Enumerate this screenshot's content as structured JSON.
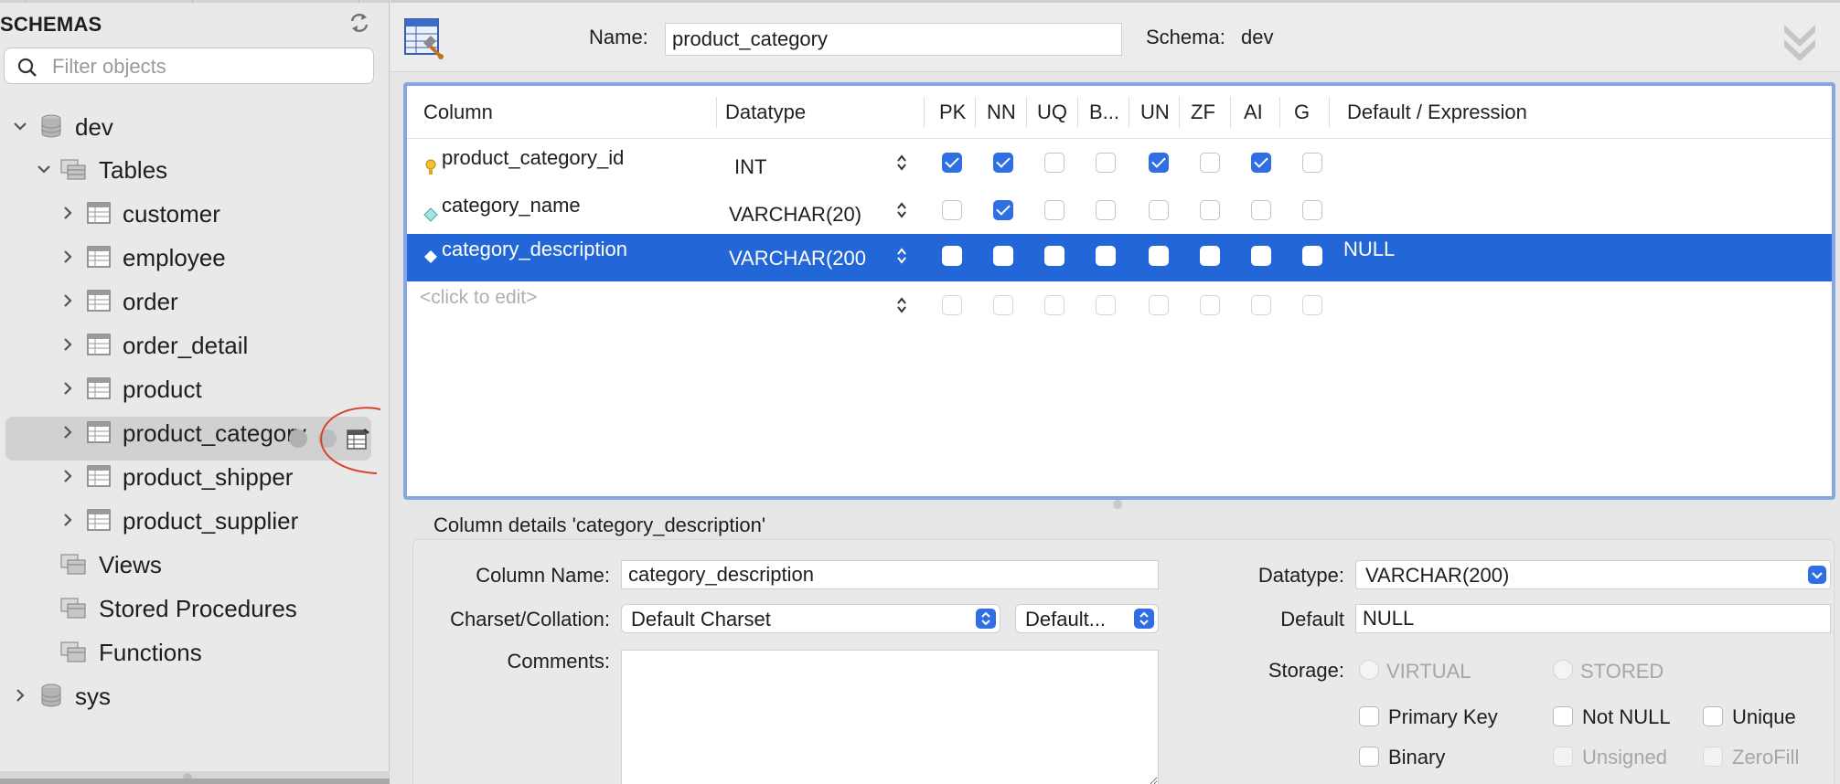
{
  "sidebar": {
    "title": "SCHEMAS",
    "filter_placeholder": "Filter objects",
    "tree": {
      "schema_dev": "dev",
      "tables_folder": "Tables",
      "tables": [
        "customer",
        "employee",
        "order",
        "order_detail",
        "product",
        "product_category",
        "product_shipper",
        "product_supplier"
      ],
      "views_folder": "Views",
      "procedures_folder": "Stored Procedures",
      "functions_folder": "Functions",
      "schema_sys": "sys"
    },
    "selected_table": "product_category"
  },
  "header": {
    "name_label": "Name:",
    "name_value": "product_category",
    "schema_label": "Schema:",
    "schema_value": "dev"
  },
  "grid": {
    "columns": [
      "Column",
      "Datatype",
      "PK",
      "NN",
      "UQ",
      "B...",
      "UN",
      "ZF",
      "AI",
      "G",
      "Default / Expression"
    ],
    "rows": [
      {
        "name": "product_category_id",
        "type": "INT",
        "flags": [
          true,
          true,
          false,
          false,
          true,
          false,
          true,
          false
        ],
        "default": "",
        "icon": "primary-key-icon"
      },
      {
        "name": "category_name",
        "type": "VARCHAR(20)",
        "flags": [
          false,
          true,
          false,
          false,
          false,
          false,
          false,
          false
        ],
        "default": "",
        "icon": "column-diamond-icon"
      },
      {
        "name": "category_description",
        "type": "VARCHAR(200",
        "flags": [
          false,
          false,
          false,
          false,
          false,
          false,
          false,
          false
        ],
        "default": "NULL",
        "icon": "column-diamond-icon",
        "selected": true
      }
    ],
    "placeholder_row": "<click to edit>"
  },
  "details": {
    "title": "Column details 'category_description'",
    "column_name_label": "Column Name:",
    "column_name_value": "category_description",
    "charset_label": "Charset/Collation:",
    "charset_value": "Default Charset",
    "collation_value": "Default...",
    "comments_label": "Comments:",
    "datatype_label": "Datatype:",
    "datatype_value": "VARCHAR(200)",
    "default_label": "Default",
    "default_value": "NULL",
    "storage_label": "Storage:",
    "storage_options": [
      "VIRTUAL",
      "STORED"
    ],
    "checkboxes": [
      {
        "label": "Primary Key",
        "disabled": false
      },
      {
        "label": "Not NULL",
        "disabled": false
      },
      {
        "label": "Unique",
        "disabled": false
      },
      {
        "label": "Binary",
        "disabled": false
      },
      {
        "label": "Unsigned",
        "disabled": true
      },
      {
        "label": "ZeroFill",
        "disabled": true
      }
    ]
  },
  "colors": {
    "selection": "#2366d8",
    "checkbox_on": "#2f6fe3",
    "grid_focus_border": "#86a6e8",
    "annotation": "#d9412e"
  }
}
